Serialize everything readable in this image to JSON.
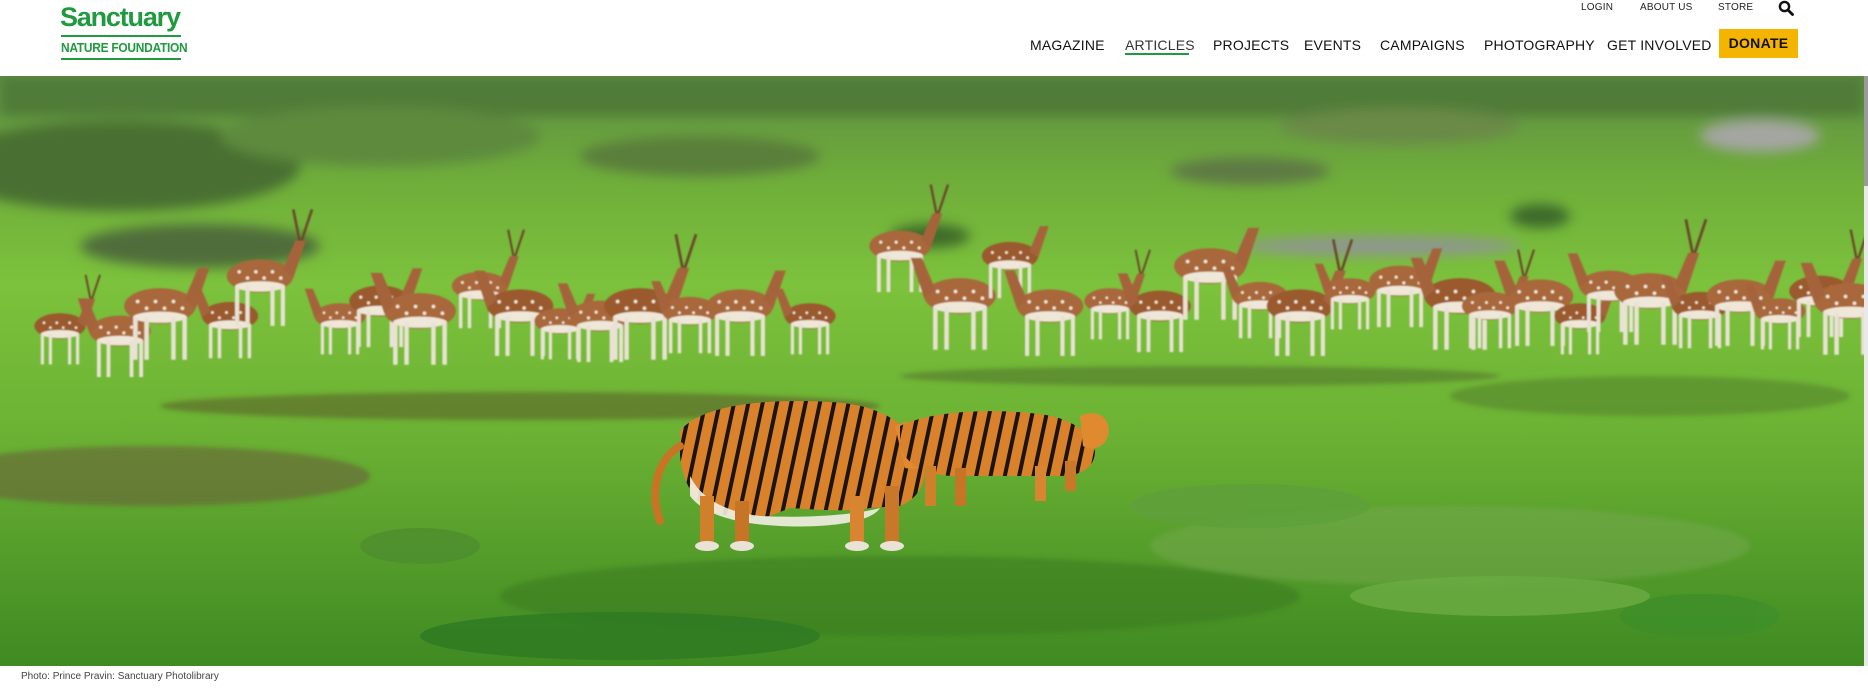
{
  "brand": {
    "name_top": "Sanctuary",
    "name_bottom": "NATURE FOUNDATION",
    "color": "#1f9a3e"
  },
  "utility_nav": {
    "login": "LOGIN",
    "about": "ABOUT US",
    "store": "STORE",
    "search_icon": "search-icon"
  },
  "main_nav": {
    "items": [
      "MAGAZINE",
      "ARTICLES",
      "PROJECTS",
      "EVENTS",
      "CAMPAIGNS",
      "PHOTOGRAPHY",
      "GET INVOLVED"
    ],
    "active": "ARTICLES",
    "donate": "DONATE",
    "donate_color": "#f5b400"
  },
  "hero": {
    "caption": "Photo: Prince Pravin: Sanctuary Photolibrary"
  }
}
